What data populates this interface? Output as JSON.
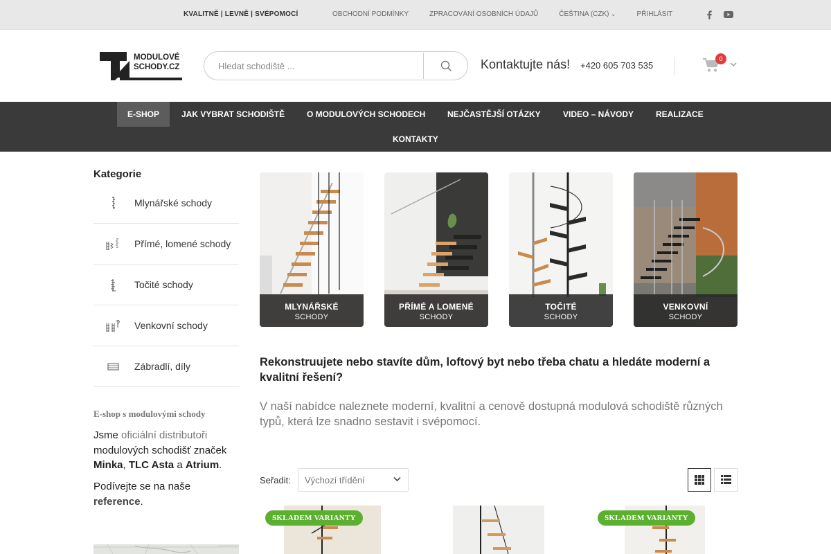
{
  "topbar": {
    "slogan": "KVALITNĚ | LEVNĚ | SVÉPOMOCÍ",
    "links": [
      "OBCHODNÍ PODMÍNKY",
      "ZPRACOVÁNÍ OSOBNÍCH ÚDAJŮ"
    ],
    "language": "ČEŠTINA (CZK)",
    "login": "PŘIHLÁSIT",
    "social": [
      "facebook-icon",
      "youtube-icon"
    ]
  },
  "header": {
    "logo_text_1": "MODULOVÉ",
    "logo_text_2": "SCHODY.CZ",
    "search_placeholder": "Hledat schodiště ...",
    "contact_title": "Kontaktujte nás!",
    "phone": "+420 605 703 535",
    "cart_count": "0"
  },
  "nav": {
    "items": [
      "E-SHOP",
      "JAK VYBRAT SCHODIŠTĚ",
      "O MODULOVÝCH SCHODECH",
      "NEJČASTĚJŠÍ OTÁZKY",
      "VIDEO – NÁVODY",
      "REALIZACE",
      "KONTAKTY"
    ]
  },
  "sidebar": {
    "title": "Kategorie",
    "categories": [
      "Mlynářské schody",
      "Přímé, lomené schody",
      "Točité schody",
      "Venkovní schody",
      "Zábradlí, díly"
    ],
    "eshop_title": "E-shop s modulovými schody",
    "eshop_text": {
      "a": "Jsme",
      "b": "oficiální distributoři",
      "c": "modulových schodišť značek",
      "d": "Minka",
      "e": "TLC Asta",
      "f": "a",
      "g": "Atrium",
      "h": "."
    },
    "eshop_text2": {
      "a": "Podívejte se na naše",
      "b": "reference",
      "c": "."
    }
  },
  "tiles": [
    {
      "line1": "MLYNÁŘSKÉ",
      "line2": "SCHODY"
    },
    {
      "line1": "PŘÍMÉ A LOMENÉ",
      "line2": "SCHODY"
    },
    {
      "line1": "TOČITÉ",
      "line2": "SCHODY"
    },
    {
      "line1": "VENKOVNÍ",
      "line2": "SCHODY"
    }
  ],
  "intro": {
    "heading": "Rekonstruujete nebo stavíte dům, loftový byt nebo třeba chatu a hledáte moderní a kvalitní řešení?",
    "text": "V naší nabídce naleznete moderní, kvalitní a cenově dostupná modulová schodiště různých typů, která lze snadno sestavit i svépomocí."
  },
  "sorting": {
    "label": "Seřadit:",
    "selected": "Výchozí třídění"
  },
  "products": {
    "badge": "SKLADEM VARIANTY"
  },
  "colors": {
    "nav_bg": "#3a3a3a",
    "nav_active": "#5c5c5c",
    "badge_green": "#5cb030",
    "cart_badge": "#e23b3b"
  }
}
